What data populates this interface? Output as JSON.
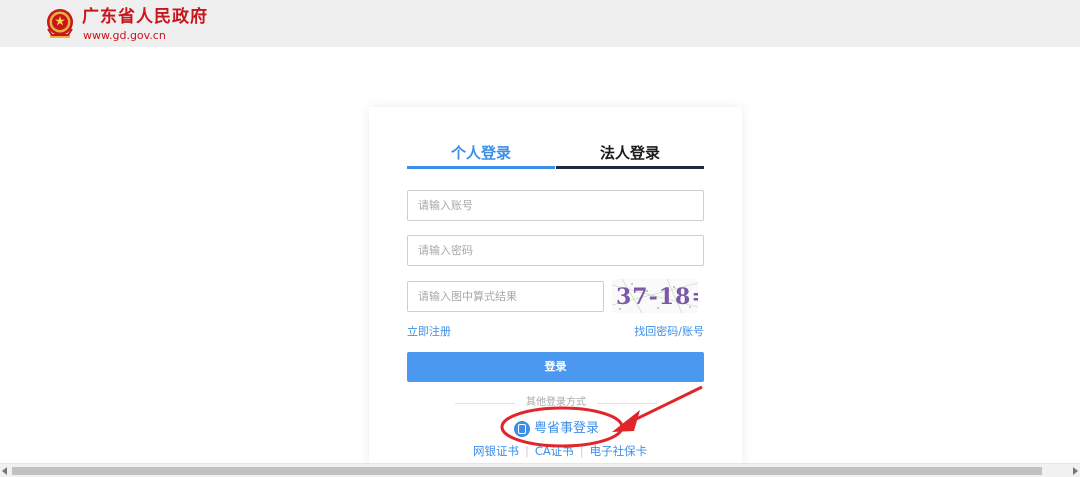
{
  "header": {
    "title": "广东省人民政府",
    "url": "www.gd.gov.cn"
  },
  "tabs": {
    "personal": "个人登录",
    "legal": "法人登录"
  },
  "form": {
    "account_placeholder": "请输入账号",
    "password_placeholder": "请输入密码",
    "captcha_placeholder": "请输入图中算式结果",
    "captcha_text": "37-18=?"
  },
  "links": {
    "register": "立即注册",
    "forgot": "找回密码/账号"
  },
  "login_button": "登录",
  "other": {
    "label": "其他登录方式",
    "ygs": "粤省事登录",
    "cert_items": [
      "网银证书",
      "CA证书",
      "电子社保卡"
    ],
    "separator": "|"
  },
  "colors": {
    "brand_red": "#c8161d",
    "accent_blue": "#3c8fe8",
    "annotation_red": "#e0262b"
  }
}
